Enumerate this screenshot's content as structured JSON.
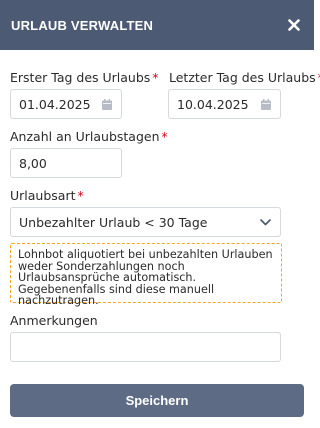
{
  "dialog": {
    "title": "URLAUB VERWALTEN"
  },
  "form": {
    "first_day": {
      "label": "Erster Tag des Urlaubs",
      "required_mark": "*",
      "value": "01.04.2025"
    },
    "last_day": {
      "label": "Letzter Tag des Urlaubs",
      "required_mark": "*",
      "value": "10.04.2025"
    },
    "days": {
      "label": "Anzahl an Urlaubstagen",
      "required_mark": "*",
      "value": "8,00"
    },
    "leave_type": {
      "label": "Urlaubsart",
      "required_mark": "*",
      "selected": "Unbezahlter Urlaub < 30 Tage"
    },
    "notice": "Lohnbot aliquotiert bei unbezahlten Urlauben weder Sonderzahlungen noch Urlaubsansprüche automatisch. Gegebenenfalls sind diese manuell nachzutragen.",
    "remarks": {
      "label": "Anmerkungen",
      "value": ""
    },
    "save_label": "Speichern"
  },
  "colors": {
    "header_bg": "#4d5a73",
    "button_bg": "#5e6b84",
    "required": "#d0021b",
    "notice_border": "#f5a623"
  },
  "icons": {
    "close": "close-icon",
    "date_picker": "calendar-icon",
    "dropdown": "chevron-down-icon"
  }
}
